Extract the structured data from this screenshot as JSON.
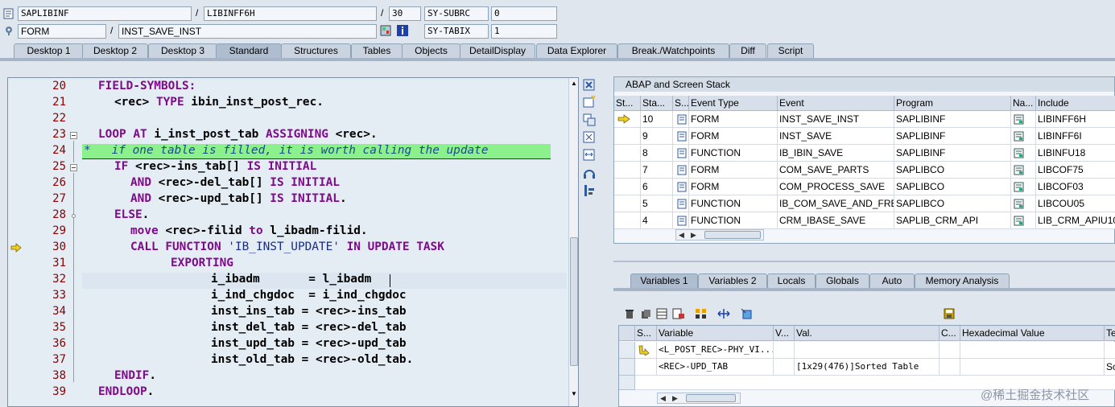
{
  "header": {
    "row1": {
      "program": "SAPLIBINF",
      "include": "LIBINFF6H",
      "line": "30",
      "sysvar": "SY-SUBRC",
      "sysval": "0"
    },
    "row2": {
      "type": "FORM",
      "name": "INST_SAVE_INST",
      "sysvar": "SY-TABIX",
      "sysval": "1"
    },
    "slash": "/"
  },
  "tabs": [
    "Desktop 1",
    "Desktop 2",
    "Desktop 3",
    "Standard",
    "Structures",
    "Tables",
    "Objects",
    "DetailDisplay",
    "Data Explorer",
    "Break./Watchpoints",
    "Diff",
    "Script"
  ],
  "active_tab": "Standard",
  "code": {
    "line_numbers": [
      "20",
      "21",
      "22",
      "23",
      "24",
      "25",
      "26",
      "27",
      "28",
      "29",
      "30",
      "31",
      "32",
      "33",
      "34",
      "35",
      "36",
      "37",
      "38",
      "39"
    ],
    "lines": {
      "l20": {
        "k1": "FIELD-SYMBOLS:"
      },
      "l21": {
        "a": "<rec> ",
        "k1": "TYPE",
        "b": " ibin_inst_post_rec."
      },
      "l23": {
        "k1": "LOOP AT",
        "a": " i_inst_post_tab ",
        "k2": "ASSIGNING",
        "b": " <rec>."
      },
      "l24": {
        "c": "*   if one table is filled, it is worth calling the update"
      },
      "l25": {
        "k1": "IF",
        "a": " <rec>-ins_tab[] ",
        "k2": "IS INITIAL"
      },
      "l26": {
        "k1": "AND",
        "a": " <rec>-del_tab[] ",
        "k2": "IS INITIAL"
      },
      "l27": {
        "k1": "AND",
        "a": " <rec>-upd_tab[] ",
        "k2": "IS INITIAL",
        "b": "."
      },
      "l28": {
        "k1": "ELSE",
        "b": "."
      },
      "l29": {
        "k1": "move",
        "a": " <rec>-filid ",
        "k2": "to",
        "b": " l_ibadm-filid."
      },
      "l30": {
        "k1": "CALL FUNCTION",
        "s": " 'IB_INST_UPDATE' ",
        "k2": "IN UPDATE TASK"
      },
      "l31": {
        "k1": "EXPORTING"
      },
      "l32": {
        "a": "i_ibadm       = l_ibadm"
      },
      "l33": {
        "a": "i_ind_chgdoc  = i_ind_chgdoc"
      },
      "l34": {
        "a": "inst_ins_tab = <rec>-ins_tab"
      },
      "l35": {
        "a": "inst_del_tab = <rec>-del_tab"
      },
      "l36": {
        "a": "inst_upd_tab = <rec>-upd_tab"
      },
      "l37": {
        "a": "inst_old_tab = <rec>-old_tab."
      },
      "l38": {
        "k1": "ENDIF",
        "b": "."
      },
      "l39": {
        "k1": "ENDLOOP",
        "b": "."
      }
    }
  },
  "stack": {
    "title": "ABAP and Screen Stack",
    "columns": [
      "St...",
      "Sta...",
      "S...",
      "Event Type",
      "Event",
      "Program",
      "Na...",
      "Include"
    ],
    "rows": [
      {
        "level": "10",
        "type": "FORM",
        "event": "INST_SAVE_INST",
        "program": "SAPLIBINF",
        "include": "LIBINFF6H",
        "current": true
      },
      {
        "level": "9",
        "type": "FORM",
        "event": "INST_SAVE",
        "program": "SAPLIBINF",
        "include": "LIBINFF6I"
      },
      {
        "level": "8",
        "type": "FUNCTION",
        "event": "IB_IBIN_SAVE",
        "program": "SAPLIBINF",
        "include": "LIBINFU18"
      },
      {
        "level": "7",
        "type": "FORM",
        "event": "COM_SAVE_PARTS",
        "program": "SAPLIBCO",
        "include": "LIBCOF75"
      },
      {
        "level": "6",
        "type": "FORM",
        "event": "COM_PROCESS_SAVE",
        "program": "SAPLIBCO",
        "include": "LIBCOF03"
      },
      {
        "level": "5",
        "type": "FUNCTION",
        "event": "IB_COM_SAVE_AND_FRE...",
        "program": "SAPLIBCO",
        "include": "LIBCOU05"
      },
      {
        "level": "4",
        "type": "FUNCTION",
        "event": "CRM_IBASE_SAVE",
        "program": "SAPLIB_CRM_API",
        "include": "LIB_CRM_APIU10"
      }
    ]
  },
  "var_tabs": [
    "Variables 1",
    "Variables 2",
    "Locals",
    "Globals",
    "Auto",
    "Memory Analysis"
  ],
  "active_var_tab": "Variables 1",
  "variables": {
    "columns": [
      "S...",
      "Variable",
      "V...",
      "Val.",
      "C...",
      "Hexadecimal Value",
      "Te"
    ],
    "rows": [
      {
        "name": "<L_POST_REC>-PHY_VI...",
        "value": "",
        "hex": "",
        "te": ""
      },
      {
        "name": "<REC>-UPD_TAB",
        "value": "[1x29(476)]Sorted Table",
        "hex": "",
        "te": "Sc"
      }
    ]
  },
  "watermark": "@稀土掘金技术社区",
  "colors": {
    "accent_comment": "#8cf08c",
    "keyword": "#7f0a8a",
    "line_number": "#8b0000",
    "current_arrow": "#f0d020"
  }
}
